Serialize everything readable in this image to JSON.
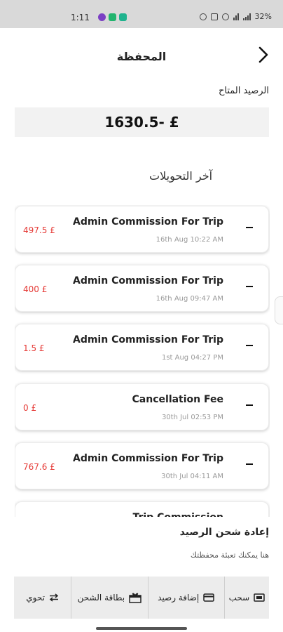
{
  "status_bar": {
    "time": "1:11",
    "battery": "32%",
    "app_colors": [
      "#7b3fc4",
      "#22b46e",
      "#1fb38e"
    ]
  },
  "header": {
    "title": "المحفظة",
    "back_icon": "chevron-right-icon"
  },
  "balance": {
    "label": "الرصيد المتاح",
    "value": "1630.5- £"
  },
  "transactions": {
    "section_title": "آخر التحويلات",
    "items": [
      {
        "title": "Admin Commission For Trip",
        "date": "16th Aug 10:22 AM",
        "amount": "497.5 £"
      },
      {
        "title": "Admin Commission For Trip",
        "date": "16th Aug 09:47 AM",
        "amount": "400 £"
      },
      {
        "title": "Admin Commission For Trip",
        "date": "1st Aug 04:27 PM",
        "amount": "1.5 £"
      },
      {
        "title": "Cancellation Fee",
        "date": "30th Jul 02:53 PM",
        "amount": "0 £"
      },
      {
        "title": "Admin Commission For Trip",
        "date": "30th Jul 04:11 AM",
        "amount": "767.6 £"
      },
      {
        "title": "Trip Commission",
        "date": "",
        "amount": ""
      }
    ]
  },
  "recharge": {
    "title": "إعادة شحن الرصيد",
    "subtitle": "هنا يمكنك تعبئة محفظتك"
  },
  "actions": {
    "withdraw": "سحب",
    "add_balance": "إضافة رصيد",
    "recharge_card": "بطاقة الشحن",
    "transfer": "تحوي"
  },
  "colors": {
    "accent_negative": "#e53935",
    "status_bar_bg": "#d9d9d9",
    "action_bar_bg": "#ececec"
  }
}
